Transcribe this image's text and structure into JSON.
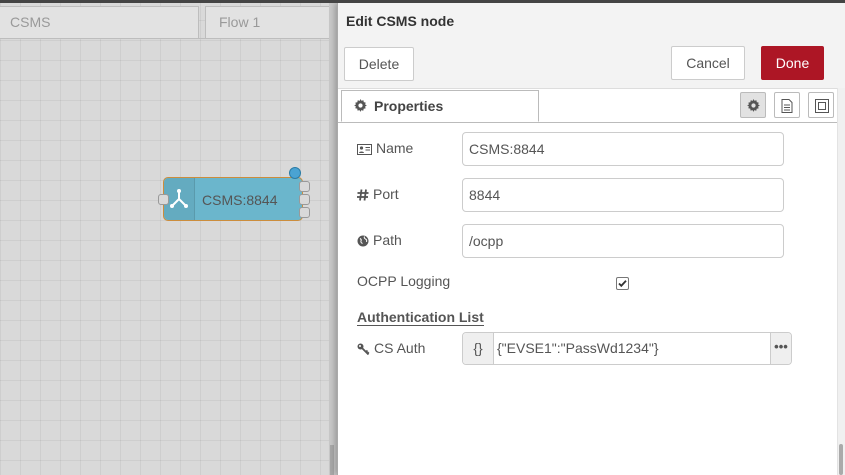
{
  "workspace": {
    "tabs": [
      {
        "label": "CSMS"
      },
      {
        "label": "Flow 1"
      }
    ],
    "node": {
      "label": "CSMS:8844",
      "icon": "network-icon",
      "color": "#6bb6cc"
    }
  },
  "tray": {
    "title": "Edit CSMS node",
    "buttons": {
      "delete": "Delete",
      "cancel": "Cancel",
      "done": "Done"
    },
    "tabs": [
      {
        "label": "Properties",
        "icon": "gear-icon"
      }
    ],
    "tool_buttons": [
      "settings-icon",
      "description-icon",
      "appearance-icon"
    ],
    "form": {
      "name": {
        "label": "Name",
        "value": "CSMS:8844",
        "icon": "id-card-icon"
      },
      "port": {
        "label": "Port",
        "value": "8844",
        "icon": "hash-icon"
      },
      "path": {
        "label": "Path",
        "value": "/ocpp",
        "icon": "globe-icon"
      },
      "logging": {
        "label": "OCPP Logging",
        "checked": true
      },
      "section_heading": "Authentication List",
      "cs_auth": {
        "label": "CS Auth",
        "type_symbol": "{}",
        "value": "{\"EVSE1\":\"PassWd1234\"}",
        "expand_symbol": "•••",
        "icon": "key-icon"
      }
    }
  },
  "colors": {
    "done_button": "#ad1625",
    "node_border": "#cc8d3d",
    "status_dot": "#4aa3d3"
  }
}
